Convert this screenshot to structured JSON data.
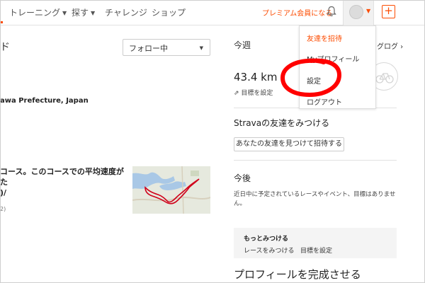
{
  "nav": {
    "items": [
      {
        "label": "トレーニング",
        "has_caret": true
      },
      {
        "label": "探す",
        "has_caret": true
      },
      {
        "label": "チャレンジ",
        "has_caret": false
      },
      {
        "label": "ショップ",
        "has_caret": false
      }
    ],
    "premium_label": "プレミアム会員になる",
    "plus_label": "+",
    "icons": [
      "bell-icon",
      "avatar",
      "chevron-down-icon",
      "plus-icon"
    ]
  },
  "feed": {
    "heading_fragment": "ド",
    "filter_value": "フォロー中",
    "location_fragment": "awa Prefecture, Japan",
    "course_text_line1": "コース。このコースでの平均速度がた",
    "course_text_line2": ")/",
    "count_fragment": "2)"
  },
  "sidebar": {
    "week_label": "今週",
    "blog_fragment": "グログ ›",
    "distance": "43.4 km",
    "goal_label": "目標を設定",
    "find_friends_title": "Stravaの友達をみつける",
    "invite_button": "あなたの友達を見つけて招待する",
    "upcoming_title": "今後",
    "upcoming_desc": "近日中に予定されているレースやイベント、目標はありません。",
    "more_title": "もっとみつける",
    "more_links": [
      "レースをみつける",
      "目標を設定"
    ],
    "profile_title": "プロフィールを完成させる"
  },
  "dropdown": {
    "items": [
      "友達を招待",
      "Myプロフィール",
      "設定",
      "ログアウト"
    ]
  },
  "colors": {
    "accent": "#fc4c02",
    "annotation": "#ff0000",
    "route": "#d0021b"
  }
}
